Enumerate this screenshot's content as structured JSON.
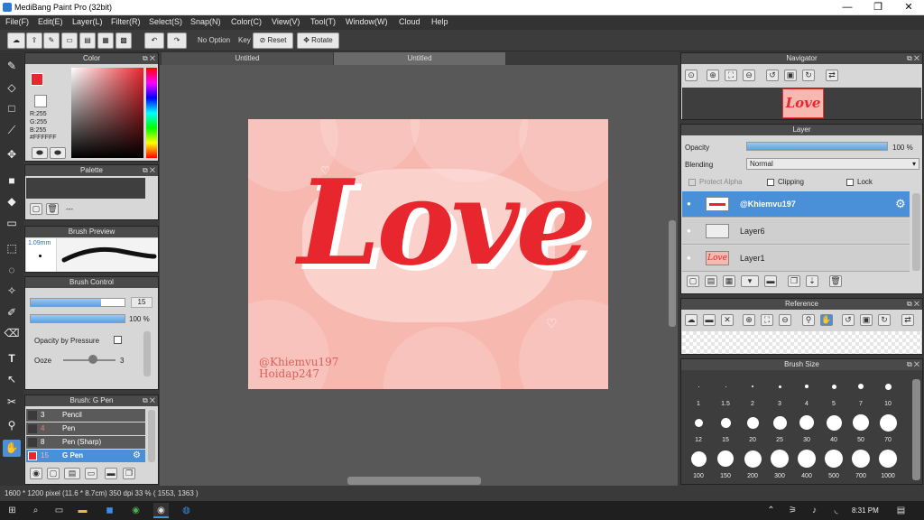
{
  "window": {
    "title": "MediBang Paint Pro (32bit)",
    "minimize": "—",
    "maximize": "❐",
    "close": "✕"
  },
  "menu": [
    "File(F)",
    "Edit(E)",
    "Layer(L)",
    "Filter(R)",
    "Select(S)",
    "Snap(N)",
    "Color(C)",
    "View(V)",
    "Tool(T)",
    "Window(W)",
    "Cloud",
    "Help"
  ],
  "toolbar": {
    "no_option": "No Option",
    "key": "Key",
    "untitled": "Untitled",
    "reset": "Reset",
    "rotate": "Rotate"
  },
  "tabs": [
    "Untitled",
    "Untitled"
  ],
  "color_panel": {
    "title": "Color",
    "r": "R:255",
    "g": "G:255",
    "b": "B:255",
    "hex": "#FFFFFF"
  },
  "palette_panel": {
    "title": "Palette",
    "dash": "---"
  },
  "brush_preview": {
    "title": "Brush Preview",
    "size": "1.09mm"
  },
  "brush_control": {
    "title": "Brush Control",
    "size_value": "15",
    "opacity_value": "100 %",
    "size_fill": 0.75,
    "opacity_fill": 1.0,
    "opacity_pressure": "Opacity by Pressure",
    "ooze": "Ooze",
    "ooze_value": "3"
  },
  "brush_list": {
    "title": "Brush: G Pen",
    "items": [
      {
        "size": "3",
        "name": "Pencil"
      },
      {
        "size": "4",
        "name": "Pen"
      },
      {
        "size": "8",
        "name": "Pen (Sharp)"
      },
      {
        "size": "15",
        "name": "G Pen"
      }
    ]
  },
  "artwork": {
    "main_text": "Love",
    "credit1": "@Khiemvu197",
    "credit2": "Hoidap247"
  },
  "navigator": {
    "title": "Navigator",
    "thumb_text": "Love"
  },
  "layer_panel": {
    "title": "Layer",
    "opacity_label": "Opacity",
    "opacity_value": "100 %",
    "opacity_fill": 1.0,
    "blending_label": "Blending",
    "blending_value": "Normal",
    "protect_alpha": "Protect Alpha",
    "clipping": "Clipping",
    "lock": "Lock",
    "layers": [
      {
        "name": "@Khiemvu197",
        "thumb": ""
      },
      {
        "name": "Layer6",
        "thumb": ""
      },
      {
        "name": "Layer1",
        "thumb": "Love"
      }
    ]
  },
  "reference": {
    "title": "Reference"
  },
  "brush_size": {
    "title": "Brush Size",
    "sizes": [
      "1",
      "1.5",
      "2",
      "3",
      "4",
      "5",
      "7",
      "10",
      "12",
      "15",
      "20",
      "25",
      "30",
      "40",
      "50",
      "70",
      "100",
      "150",
      "200",
      "300",
      "400",
      "500",
      "700",
      "1000"
    ]
  },
  "status": {
    "text": "1600 * 1200 pixel  (11.6 * 8.7cm)  350 dpi  33 %  ( 1553, 1363 )"
  },
  "taskbar": {
    "time": "8:31 PM"
  },
  "colors": {
    "accent": "#4a90d9",
    "love": "#e8262e",
    "canvas_bg": "#f7b8b0"
  }
}
